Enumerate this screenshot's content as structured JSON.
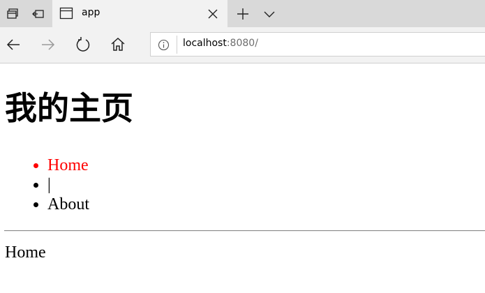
{
  "browser": {
    "tab": {
      "title": "app"
    },
    "address_bar": {
      "url_host": "localhost",
      "url_rest": ":8080/"
    },
    "icons": {
      "tab_actions_left": "tab-aside-icon",
      "tab_actions_right": "set-aside-icon",
      "favicon": "page-icon",
      "close": "close-icon",
      "new_tab": "plus-icon",
      "tab_list": "chevron-down-icon",
      "back": "back-arrow-icon",
      "forward": "forward-arrow-icon",
      "refresh": "refresh-icon",
      "home": "home-icon",
      "info": "info-icon"
    }
  },
  "page": {
    "title": "我的主页",
    "nav": [
      {
        "label": "Home",
        "active": true
      },
      {
        "label": "|",
        "active": false
      },
      {
        "label": "About",
        "active": false
      }
    ],
    "content": "Home",
    "colors": {
      "active_link": "#ff0000",
      "text": "#000000"
    }
  }
}
